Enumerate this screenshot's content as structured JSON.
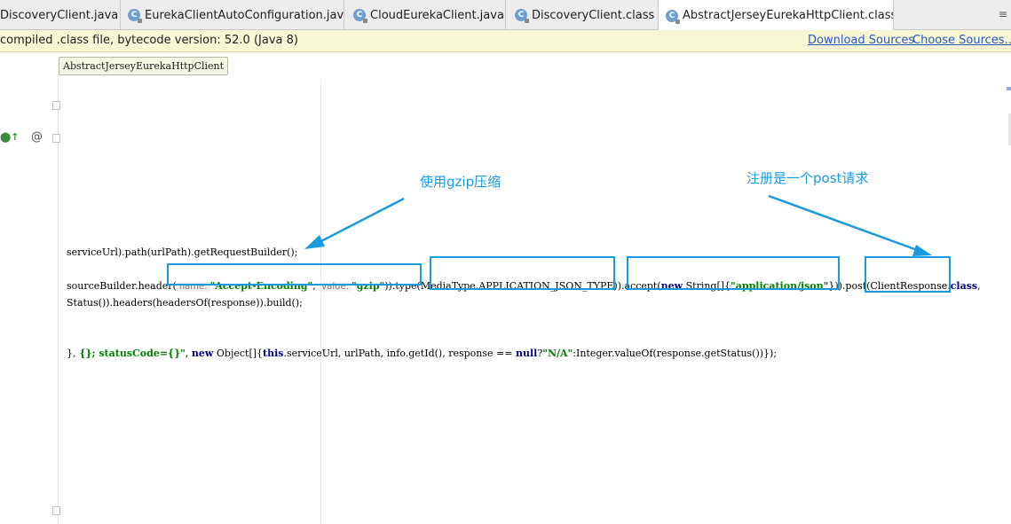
{
  "tabs": [
    {
      "label": "DiscoveryClient.java",
      "icon": "none",
      "active": false
    },
    {
      "label": "EurekaClientAutoConfiguration.java",
      "icon": "class-icon",
      "active": false
    },
    {
      "label": "CloudEurekaClient.java",
      "icon": "class-icon",
      "active": false
    },
    {
      "label": "DiscoveryClient.class",
      "icon": "class-icon",
      "active": false
    },
    {
      "label": "AbstractJerseyEurekaHttpClient.class",
      "icon": "class-icon",
      "active": true
    }
  ],
  "tab_close_glyph": "×",
  "tab_menu_glyph": "≡",
  "notice": {
    "message": "compiled .class file, bytecode version: 52.0 (Java 8)",
    "download_sources": "Download Sources",
    "choose_sources": "Choose Sources..."
  },
  "breadcrumb": "AbstractJerseyEurekaHttpClient",
  "code": {
    "line1": "serviceUrl).path(urlPath).getRequestBuilder();",
    "line2_a": "sourceBuilder.header(",
    "line2_hint1": "name:",
    "line2_str1": "\"Accept-Encoding\"",
    "line2_sep": ",",
    "line2_hint2": "value:",
    "line2_str2": "\"gzip\"",
    "line2_b": ")).type(MediaType.APPLICATION_JSON_TYPE)).accept(",
    "line2_kw_new": "new",
    "line2_c": " String[]{",
    "line2_str3": "\"application/json\"",
    "line2_d": "})).post(ClientResponse.",
    "line2_kw_class": "class",
    "line2_e": ",",
    "line3": "Status()).headers(headersOf(response)).build();",
    "line4_a": "},",
    "line4_str": " {}; statusCode={}\"",
    "line4_b": ", ",
    "line4_kw_new": "new",
    "line4_c": " Object[]{",
    "line4_kw_this": "this",
    "line4_d": ".serviceUrl, urlPath, info.getId(), response == ",
    "line4_kw_null": "null",
    "line4_e": "?",
    "line4_str2": "\"N/A\"",
    "line4_f": ":Integer.valueOf(response.getStatus())});"
  },
  "annotations": {
    "gzip": "使用gzip压缩",
    "post": "注册是一个post请求"
  },
  "colors": {
    "annotation": "#1a9be0",
    "keyword": "#000080",
    "string": "#008000",
    "notice_bg": "#f7f7d3",
    "link": "#2b56c6"
  }
}
